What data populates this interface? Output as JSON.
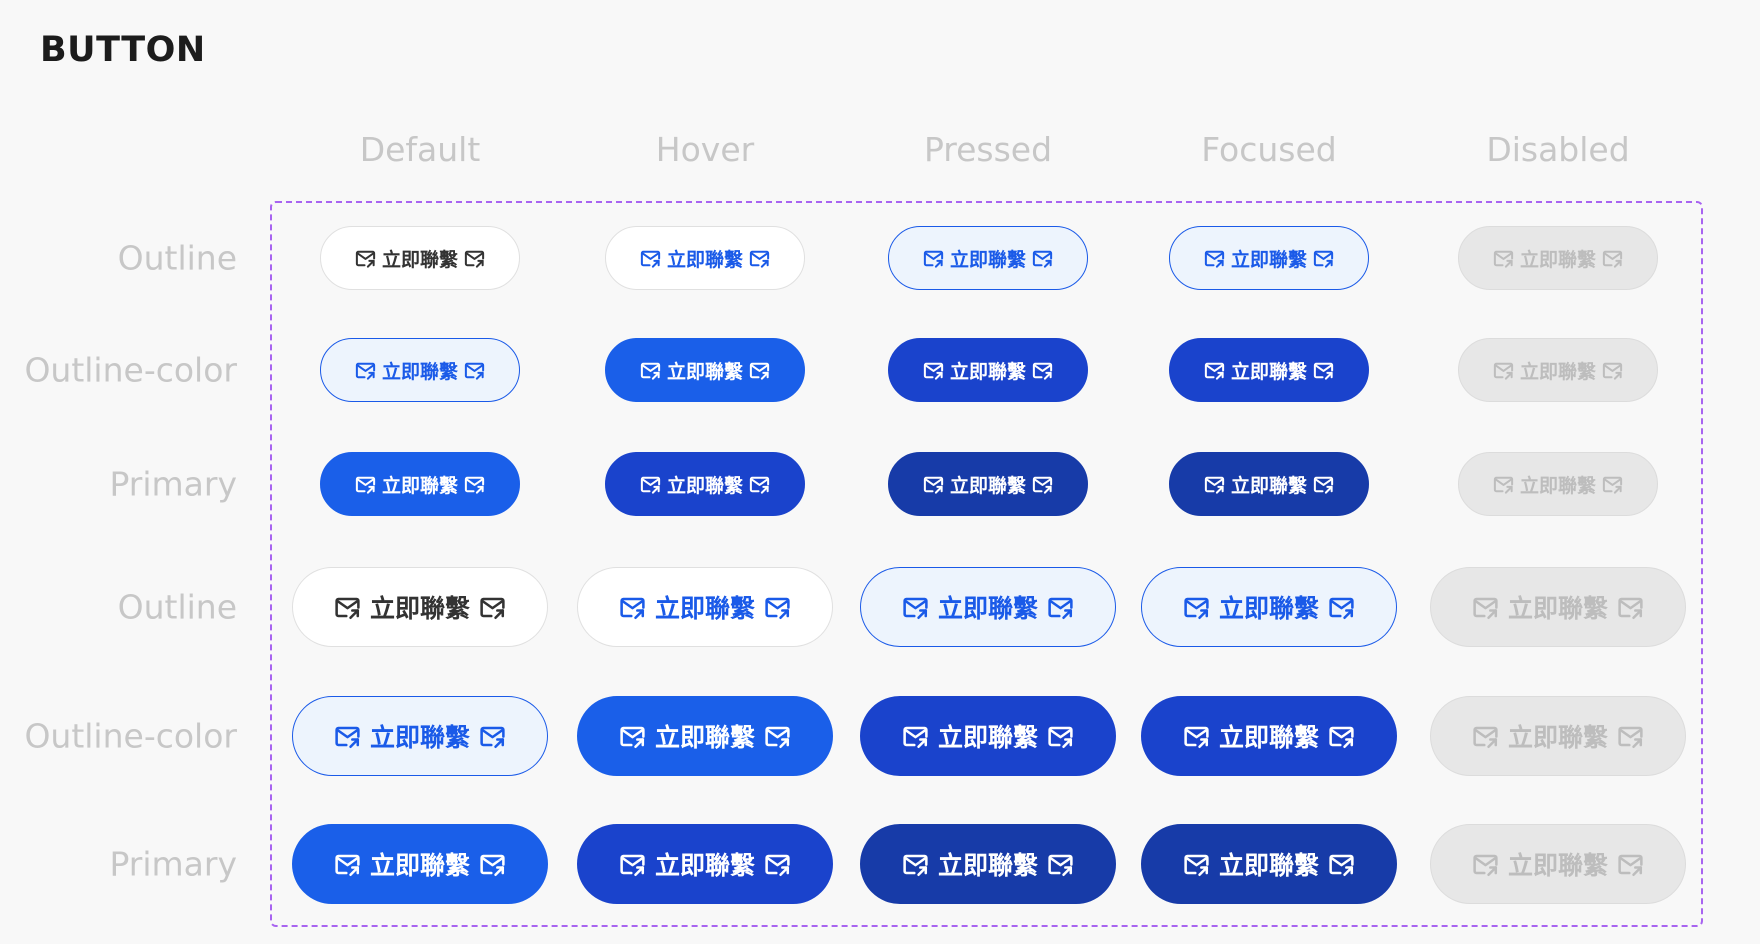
{
  "page_title": "BUTTON",
  "columns": [
    "Default",
    "Hover",
    "Pressed",
    "Focused",
    "Disabled"
  ],
  "rows": [
    "Outline",
    "Outline-color",
    "Primary",
    "Outline",
    "Outline-color",
    "Primary"
  ],
  "button_label": "立即聯繫",
  "icons": {
    "left": "mail-send-icon",
    "right": "mail-send-icon"
  },
  "colors": {
    "primary": "#1a5fe9",
    "primary_hover": "#1a43cc",
    "primary_pressed": "#173ba8",
    "tint_background": "#edf4fd",
    "disabled_background": "#e7e7e7",
    "disabled_text": "#bdbdbd",
    "frame_dash": "#a864f0",
    "label_gray": "#c7c7c7"
  }
}
